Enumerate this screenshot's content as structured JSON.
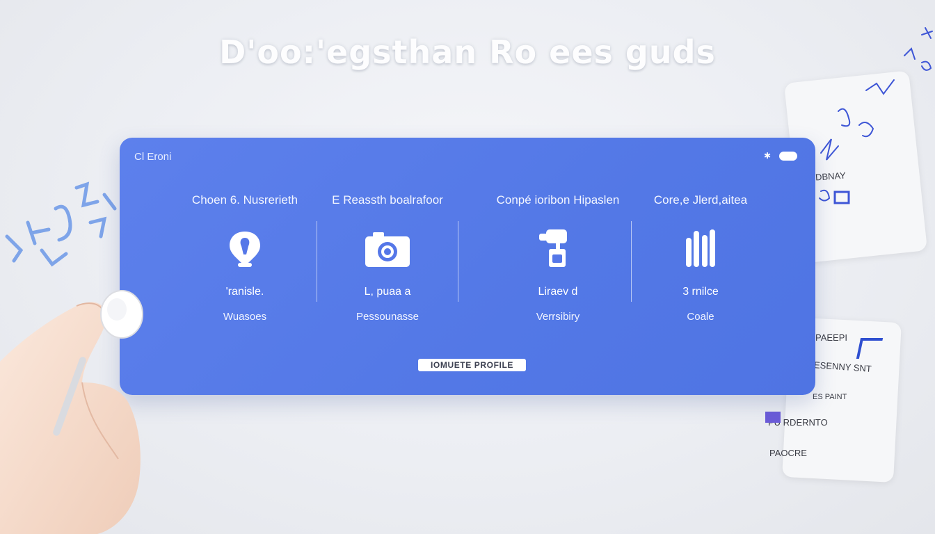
{
  "hero": {
    "title": "D'oo:'egsthan Ro ees guds"
  },
  "panel": {
    "title": "Cl Eroni",
    "columns": [
      {
        "heading": "Choen 6. Nusrerieth",
        "icon": "location-pin-icon",
        "label": "'ranisle.",
        "sub": "Wuasoes"
      },
      {
        "heading": "E Reassth boalrafoor",
        "icon": "camera-icon",
        "label": "L, puaa a",
        "sub": "Pessounasse"
      },
      {
        "heading": "Conpé ioribon Hipaslen",
        "icon": "mixer-device-icon",
        "label": "Liraev d",
        "sub": "Verrsibiry"
      },
      {
        "heading": "Core,e Jlerd,aitea",
        "icon": "bars-icon",
        "label": "3 rnilce",
        "sub": "Coale"
      }
    ],
    "cta_label": "IOMUETE PROFILE"
  },
  "side_notes": [
    "DBNAY",
    "PAEEPI",
    "ESENNY SNT",
    "ES PAINT",
    "PU RDERNTO",
    "PAOCRE"
  ],
  "colors": {
    "panel": "#5678e8",
    "background": "#eceef2",
    "accent_ink": "#3d5ee0"
  }
}
